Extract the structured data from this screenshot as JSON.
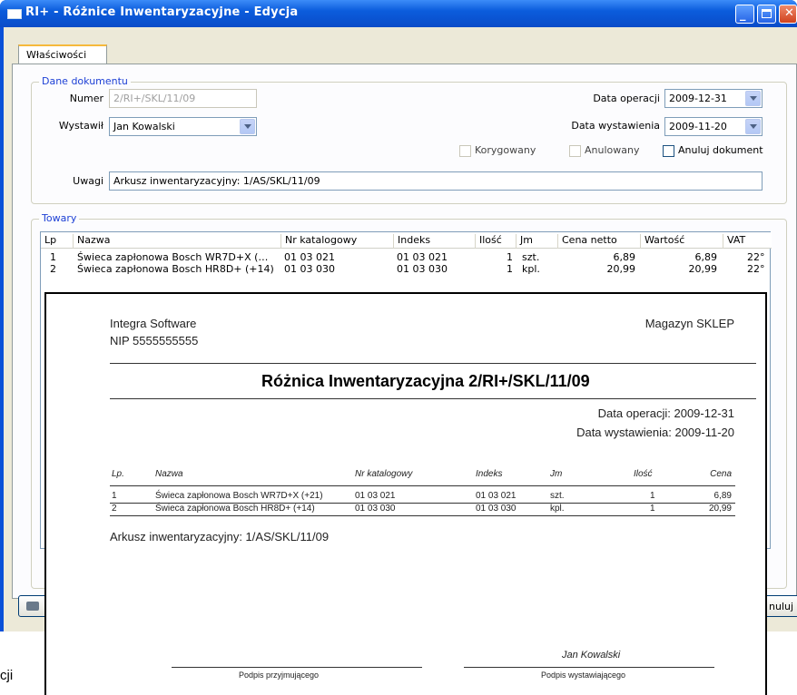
{
  "window": {
    "title": "RI+ - Różnice Inwentaryzacyjne - Edycja"
  },
  "tabs": [
    {
      "label": "Właściwości"
    }
  ],
  "dane": {
    "legend": "Dane dokumentu",
    "numer_label": "Numer",
    "numer_value": "2/RI+/SKL/11/09",
    "wystawil_label": "Wystawił",
    "wystawil_value": "Jan Kowalski",
    "data_operacji_label": "Data operacji",
    "data_operacji_value": "2009-12-31",
    "data_wystawienia_label": "Data wystawienia",
    "data_wystawienia_value": "2009-11-20",
    "korygowany_label": "Korygowany",
    "anulowany_label": "Anulowany",
    "anuluj_label": "Anuluj dokument",
    "uwagi_label": "Uwagi",
    "uwagi_value": "Arkusz inwentaryzacyjny: 1/AS/SKL/11/09"
  },
  "towary": {
    "legend": "Towary",
    "columns": [
      "Lp",
      "Nazwa",
      "Nr katalogowy",
      "Indeks",
      "Ilość",
      "Jm",
      "Cena netto",
      "Wartość",
      "VAT"
    ],
    "rows": [
      {
        "lp": "1",
        "nazwa": "Świeca zapłonowa Bosch WR7D+X (…",
        "nr": "01 03 021",
        "indeks": "01 03 021",
        "ilosc": "1",
        "jm": "szt.",
        "cena": "6,89",
        "wartosc": "6,89",
        "vat": "22°"
      },
      {
        "lp": "2",
        "nazwa": "Świeca zapłonowa Bosch HR8D+ (+14)",
        "nr": "01 03 030",
        "indeks": "01 03 030",
        "ilosc": "1",
        "jm": "kpl.",
        "cena": "20,99",
        "wartosc": "20,99",
        "vat": "22°"
      }
    ]
  },
  "buttons": {
    "anuluj_partial": "nuluj"
  },
  "partial_text": "cji",
  "report": {
    "company": "Integra Software",
    "nip": "NIP 5555555555",
    "warehouse": "Magazyn SKLEP",
    "title": "Różnica Inwentaryzacyjna 2/RI+/SKL/11/09",
    "data_operacji": "Data operacji: 2009-12-31",
    "data_wystawienia": "Data wystawienia: 2009-11-20",
    "columns": [
      "Lp.",
      "Nazwa",
      "Nr katalogowy",
      "Indeks",
      "Jm",
      "Ilość",
      "Cena"
    ],
    "rows": [
      {
        "lp": "1",
        "nazwa": "Świeca zapłonowa Bosch WR7D+X (+21)",
        "nr": "01 03 021",
        "indeks": "01 03 021",
        "jm": "szt.",
        "ilosc": "1",
        "cena": "6,89"
      },
      {
        "lp": "2",
        "nazwa": "Świeca zapłonowa Bosch HR8D+ (+14)",
        "nr": "01 03 030",
        "indeks": "01 03 030",
        "jm": "kpl.",
        "ilosc": "1",
        "cena": "20,99"
      }
    ],
    "uwagi": "Arkusz inwentaryzacyjny: 1/AS/SKL/11/09",
    "signer": "Jan Kowalski",
    "sig_left": "Podpis przyjmującego",
    "sig_right": "Podpis wystawiającego"
  }
}
